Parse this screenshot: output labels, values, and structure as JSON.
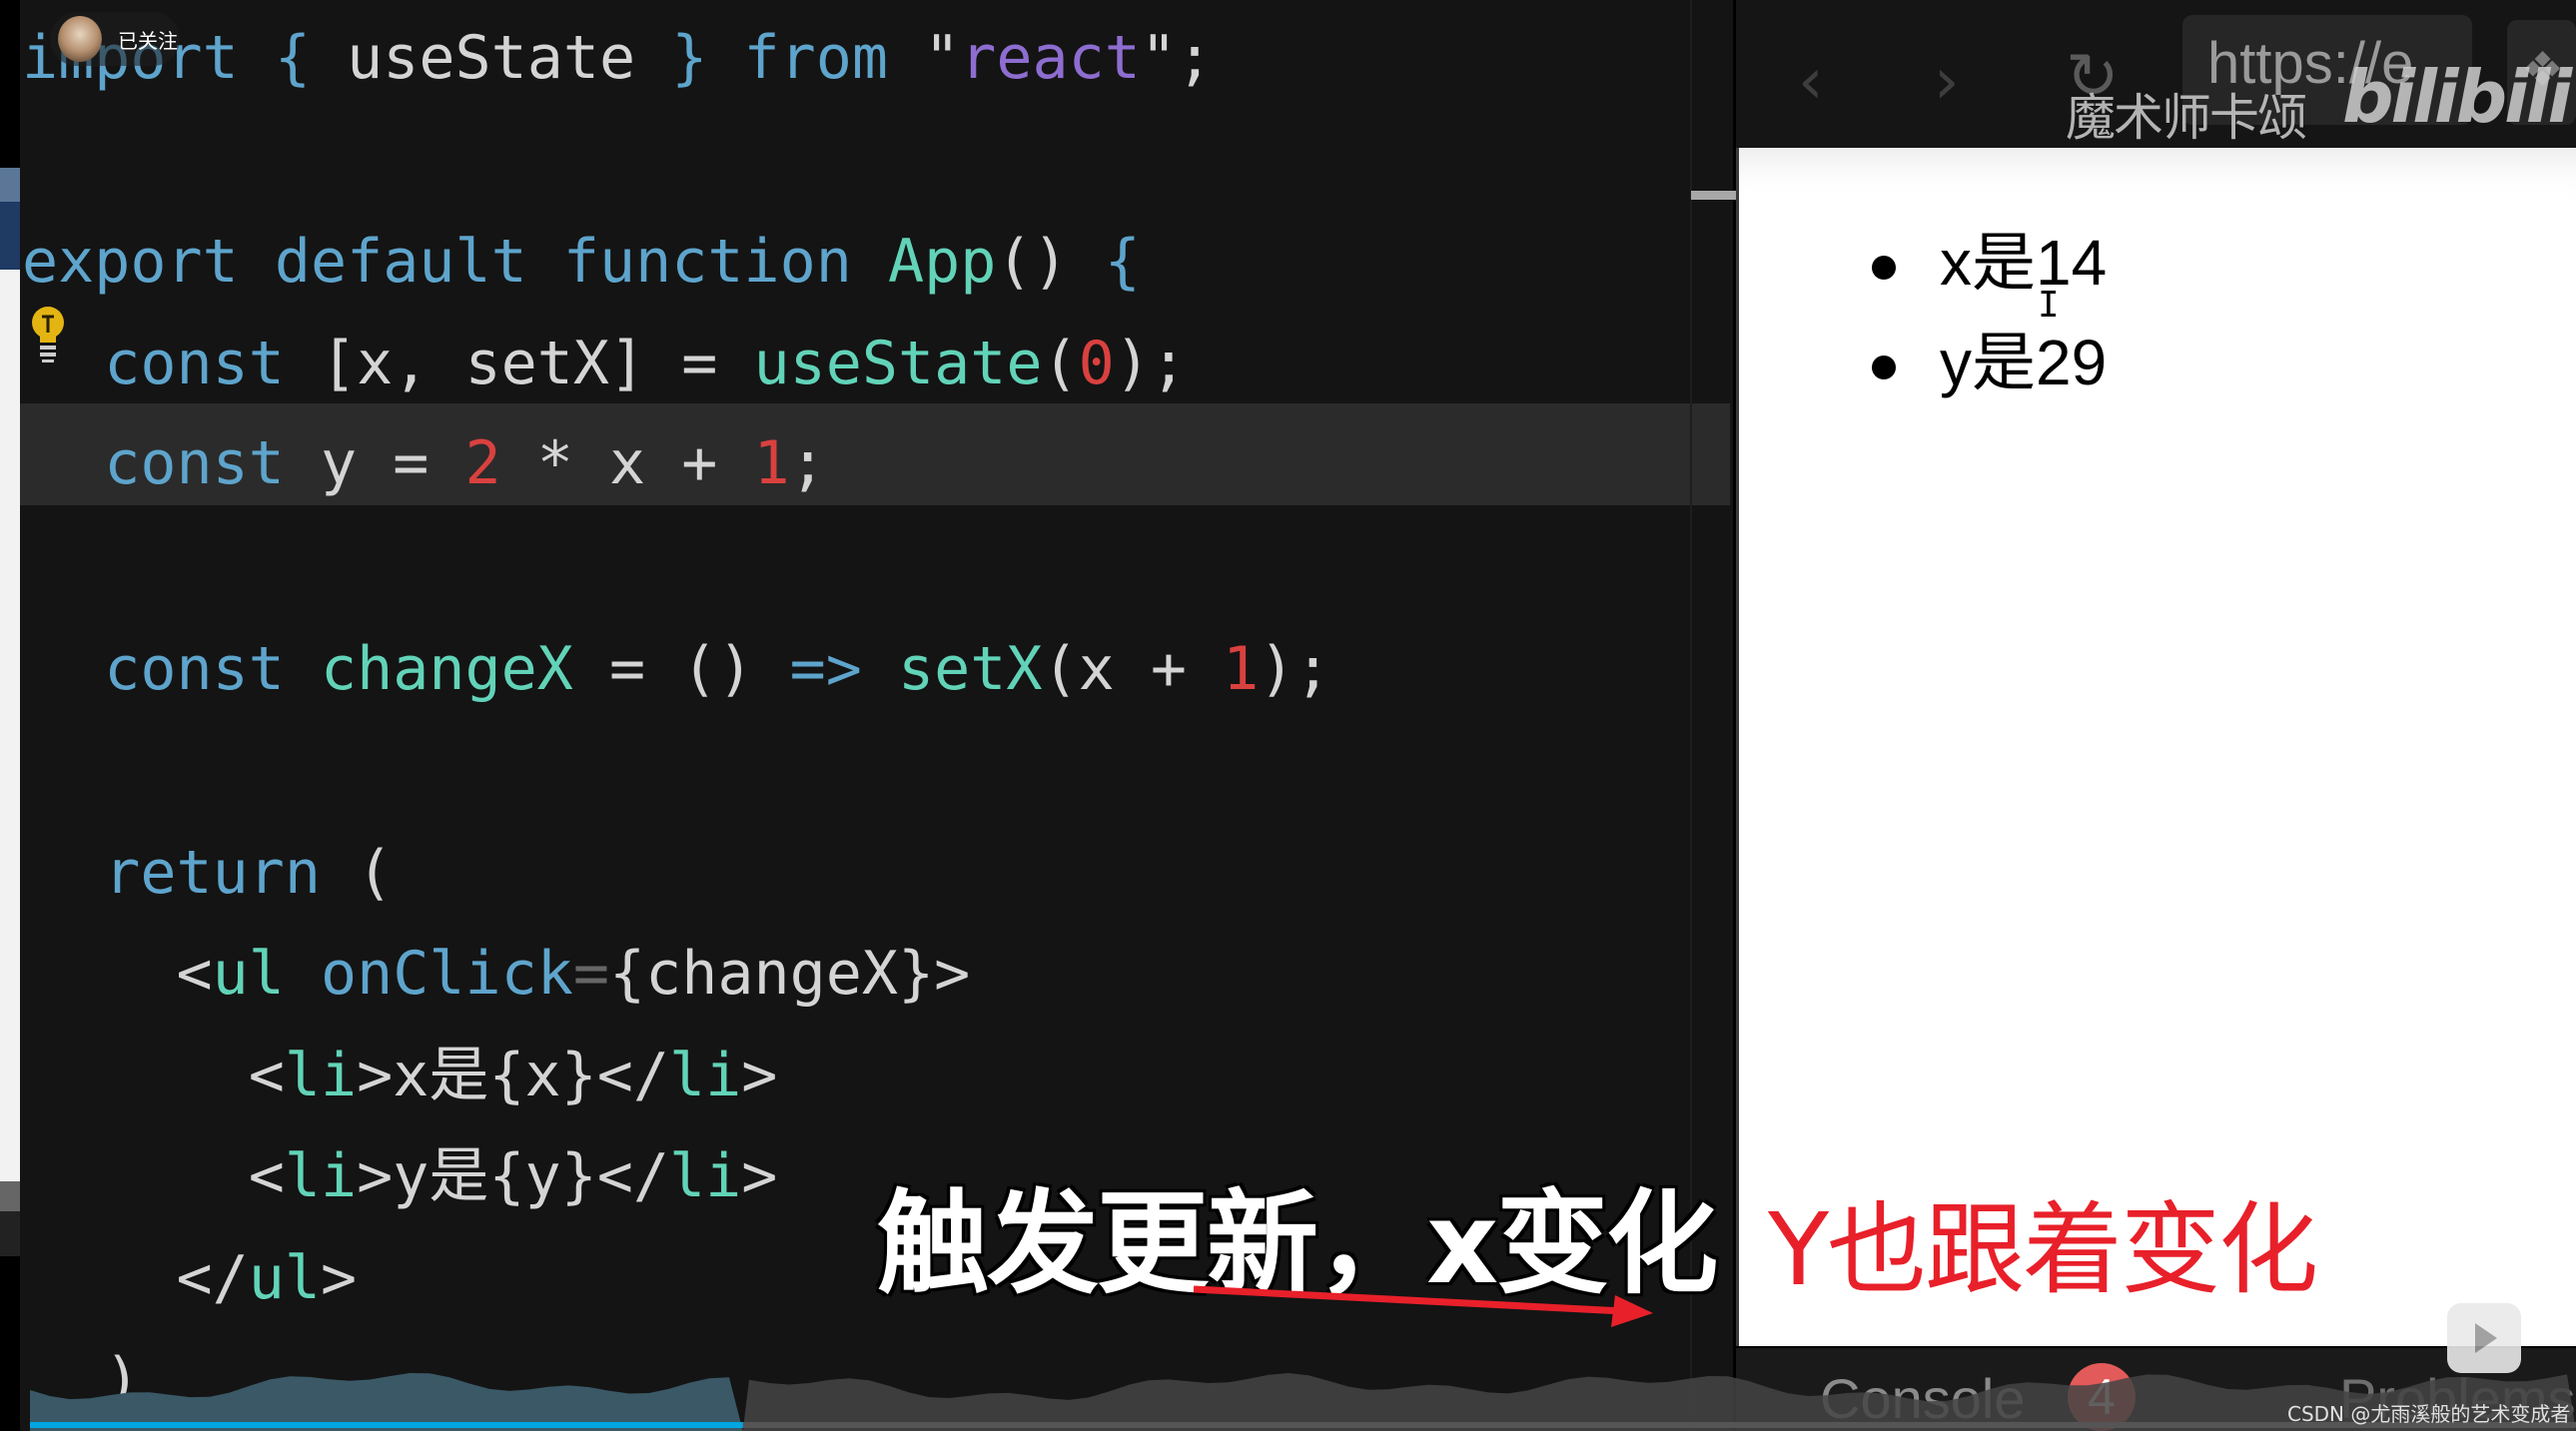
{
  "uploader": {
    "follow_status": "已关注"
  },
  "editor": {
    "lines": [
      [
        [
          "kw",
          "import"
        ],
        [
          "pl",
          " "
        ],
        [
          "kw",
          "{"
        ],
        [
          "pl",
          " useState "
        ],
        [
          "kw",
          "}"
        ],
        [
          "pl",
          " "
        ],
        [
          "kw",
          "from"
        ],
        [
          "pl",
          " \""
        ],
        [
          "str",
          "react"
        ],
        [
          "pl",
          "\";"
        ]
      ],
      [
        [
          "kw",
          "export default function"
        ],
        [
          "pl",
          " "
        ],
        [
          "fn",
          "App"
        ],
        [
          "pl",
          "() "
        ],
        [
          "kw",
          "{"
        ]
      ],
      [
        [
          "kw",
          "  const"
        ],
        [
          "pl",
          " [x, setX] = "
        ],
        [
          "fn",
          "useState"
        ],
        [
          "pl",
          "("
        ],
        [
          "num",
          "0"
        ],
        [
          "pl",
          ");"
        ]
      ],
      [
        [
          "kw",
          "  const"
        ],
        [
          "pl",
          " y = "
        ],
        [
          "num",
          "2"
        ],
        [
          "pl",
          " * x + "
        ],
        [
          "num",
          "1"
        ],
        [
          "pl",
          ";"
        ]
      ],
      [
        [
          "kw",
          "  const"
        ],
        [
          "pl",
          " "
        ],
        [
          "fn",
          "changeX"
        ],
        [
          "pl",
          " = () "
        ],
        [
          "kw",
          "=>"
        ],
        [
          "pl",
          " "
        ],
        [
          "fn",
          "setX"
        ],
        [
          "pl",
          "(x + "
        ],
        [
          "num",
          "1"
        ],
        [
          "pl",
          ");"
        ]
      ],
      [
        [
          "kw",
          "  return"
        ],
        [
          "pl",
          " ("
        ]
      ],
      [
        [
          "pl",
          "    <"
        ],
        [
          "fn",
          "ul"
        ],
        [
          "pl",
          " "
        ],
        [
          "kw",
          "onClick"
        ],
        [
          "dim",
          "="
        ],
        [
          "pl",
          "{changeX}>"
        ]
      ],
      [
        [
          "pl",
          "      <"
        ],
        [
          "fn",
          "li"
        ],
        [
          "pl",
          ">x是{x}</"
        ],
        [
          "fn",
          "li"
        ],
        [
          "pl",
          ">"
        ]
      ],
      [
        [
          "pl",
          "      <"
        ],
        [
          "fn",
          "li"
        ],
        [
          "pl",
          ">y是{y}</"
        ],
        [
          "fn",
          "li"
        ],
        [
          "pl",
          ">"
        ]
      ],
      [
        [
          "pl",
          "    </"
        ],
        [
          "fn",
          "ul"
        ],
        [
          "pl",
          ">"
        ]
      ],
      [
        [
          "pl",
          "  )"
        ]
      ]
    ]
  },
  "browser": {
    "back_icon": "chevron-left-icon",
    "forward_icon": "chevron-right-icon",
    "reload_icon": "reload-icon",
    "url": "https://e",
    "extension_icon": "extension-icon"
  },
  "watermark": {
    "channel_name": "魔术师卡颂",
    "platform_logo": "bilibili"
  },
  "preview": {
    "items": [
      "x是14",
      "y是29"
    ]
  },
  "captions": {
    "white": "触发更新，x变化",
    "red": "Y也跟着变化"
  },
  "devtools": {
    "console_label": "Console",
    "console_count": "4",
    "problems_label": "Problems"
  },
  "credit": "CSDN @尤雨溪般的艺术变成者",
  "colors": {
    "keyword": "#5ea4cc",
    "function": "#62d3b8",
    "number": "#d9413f",
    "string": "#8e6dd1",
    "caption_red": "#e8202a",
    "badge": "#e25a5a"
  },
  "video": {
    "played_fraction": 0.28
  }
}
